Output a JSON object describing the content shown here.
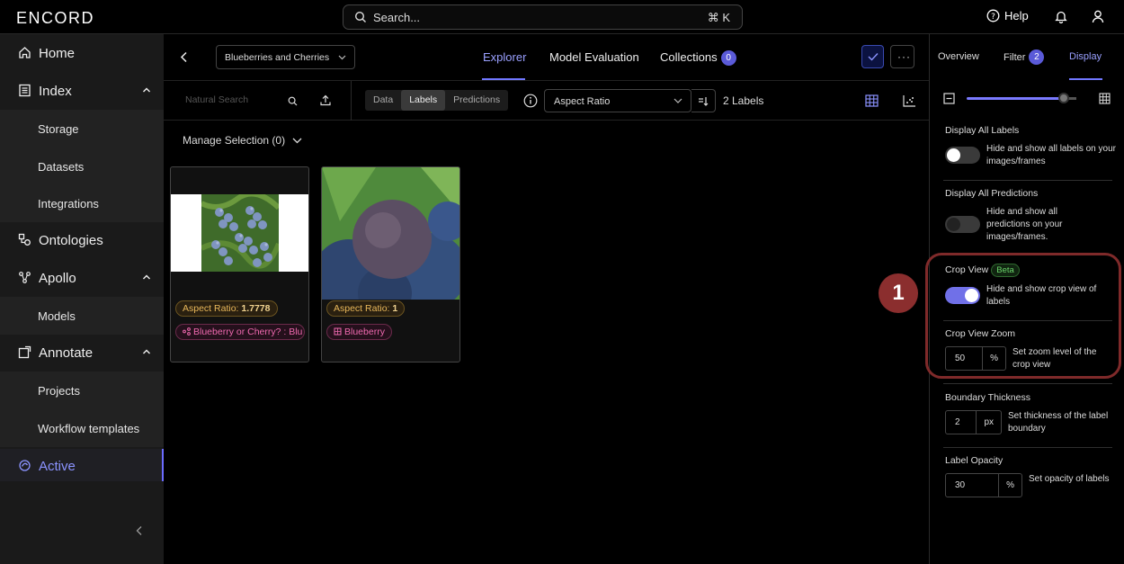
{
  "app": {
    "logo": "ENCORD"
  },
  "search": {
    "placeholder": "Search...",
    "shortcut": "⌘ K"
  },
  "header": {
    "help": "Help"
  },
  "sidebar": {
    "home": "Home",
    "index": "Index",
    "storage": "Storage",
    "datasets": "Datasets",
    "integrations": "Integrations",
    "ontologies": "Ontologies",
    "apollo": "Apollo",
    "models": "Models",
    "annotate": "Annotate",
    "projects": "Projects",
    "workflow_templates": "Workflow templates",
    "active": "Active"
  },
  "main": {
    "dataset": "Blueberries and Cherries",
    "tabs": {
      "explorer": "Explorer",
      "model_evaluation": "Model Evaluation",
      "collections": "Collections",
      "collections_count": "0"
    },
    "toolbar": {
      "natural_search": "Natural Search",
      "segments": {
        "data": "Data",
        "labels": "Labels",
        "predictions": "Predictions"
      },
      "sort_by": "Aspect Ratio",
      "label_count": "2 Labels"
    },
    "manage_selection": "Manage Selection (0)",
    "cards": [
      {
        "aspect_label": "Aspect Ratio: ",
        "aspect_value": "1.7778",
        "class": "Blueberry or Cherry? : Blu"
      },
      {
        "aspect_label": "Aspect Ratio: ",
        "aspect_value": "1",
        "class": "Blueberry"
      }
    ]
  },
  "panel": {
    "tabs": {
      "overview": "Overview",
      "filter": "Filter",
      "filter_count": "2",
      "display": "Display"
    },
    "display_all_labels": {
      "title": "Display All Labels",
      "desc": "Hide and show all labels on your images/frames"
    },
    "display_all_predictions": {
      "title": "Display All Predictions",
      "desc": "Hide and show all predictions on your images/frames."
    },
    "crop_view": {
      "title": "Crop View",
      "badge": "Beta",
      "desc": "Hide and show crop view of labels"
    },
    "crop_view_zoom": {
      "title": "Crop View Zoom",
      "value": "50",
      "unit": "%",
      "desc": "Set zoom level of the crop view"
    },
    "boundary_thickness": {
      "title": "Boundary Thickness",
      "value": "2",
      "unit": "px",
      "desc": "Set thickness of the label boundary"
    },
    "label_opacity": {
      "title": "Label Opacity",
      "value": "30",
      "unit": "%",
      "desc": "Set opacity of labels"
    }
  },
  "callout": "1"
}
